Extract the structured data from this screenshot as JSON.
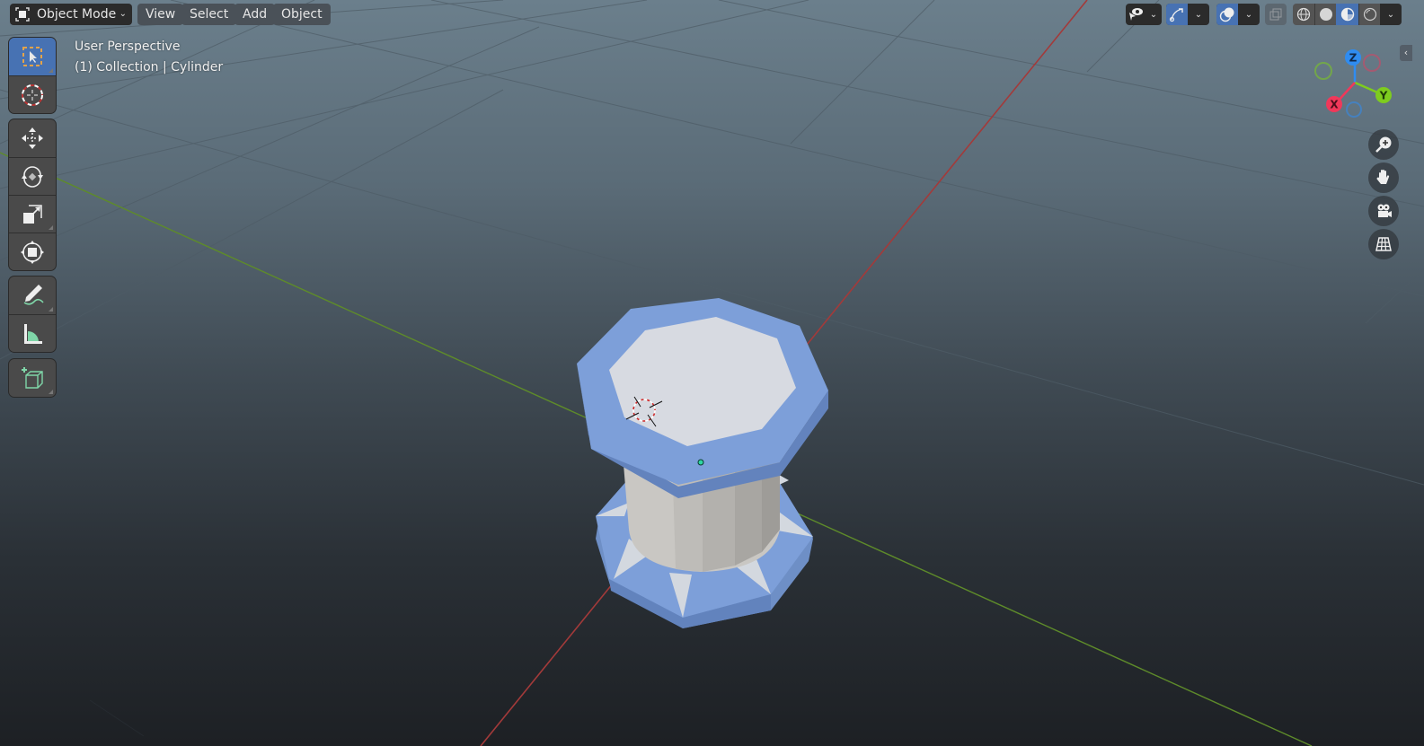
{
  "header": {
    "mode": {
      "label": "Object Mode",
      "icon": "object-mode-icon"
    },
    "menus": [
      {
        "label": "View"
      },
      {
        "label": "Select"
      },
      {
        "label": "Add"
      },
      {
        "label": "Object"
      }
    ],
    "right_controls": {
      "visibility": {
        "icon": "selectability-visibility-icon"
      },
      "gizmos": {
        "icon": "gizmo-icon",
        "active": true
      },
      "overlays": {
        "icon": "overlays-icon",
        "active": true
      },
      "xray": {
        "icon": "xray-icon",
        "active": false
      },
      "shading_modes": [
        {
          "name": "wireframe",
          "icon": "wireframe-shading-icon",
          "active": false
        },
        {
          "name": "solid",
          "icon": "solid-shading-icon",
          "active": false
        },
        {
          "name": "material-preview",
          "icon": "material-preview-icon",
          "active": true
        },
        {
          "name": "rendered",
          "icon": "rendered-shading-icon",
          "active": false
        }
      ]
    }
  },
  "overlay_info": {
    "view_name": "User Perspective",
    "collection_object": "(1) Collection | Cylinder"
  },
  "toolbar": {
    "tools": [
      {
        "name": "select-box",
        "active": true
      },
      {
        "name": "cursor",
        "active": false
      },
      {
        "name": "move",
        "active": false
      },
      {
        "name": "rotate",
        "active": false
      },
      {
        "name": "scale",
        "active": false
      },
      {
        "name": "transform",
        "active": false
      },
      {
        "name": "annotate",
        "active": false
      },
      {
        "name": "measure",
        "active": false
      },
      {
        "name": "add-cube",
        "active": false
      }
    ]
  },
  "nav_gizmo": {
    "axes": [
      {
        "label": "X",
        "color": "#f0385a"
      },
      {
        "label": "Y",
        "color": "#7ecc1e"
      },
      {
        "label": "Z",
        "color": "#2f8cf0"
      }
    ],
    "buttons": [
      {
        "name": "zoom",
        "icon": "zoom-icon"
      },
      {
        "name": "pan",
        "icon": "hand-icon"
      },
      {
        "name": "camera",
        "icon": "camera-icon"
      },
      {
        "name": "ortho-toggle",
        "icon": "grid-icon"
      }
    ]
  },
  "scene": {
    "active_object": "Cylinder",
    "colors": {
      "object_blue": "#7b9fd8",
      "object_light": "#d6d9de",
      "axis_x": "#a33a3a",
      "axis_y": "#5e8b2a"
    }
  }
}
